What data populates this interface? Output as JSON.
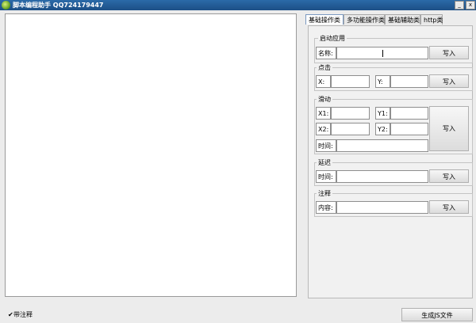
{
  "window": {
    "title": "脚本编程助手 QQ724179447",
    "minimize": "_",
    "close": "x"
  },
  "tabs": [
    "基础操作类",
    "多功能操作类",
    "基础辅助类",
    "http类"
  ],
  "launch_app": {
    "title": "启动应用",
    "name_label": "名称:",
    "name_value": "",
    "write": "写入"
  },
  "click": {
    "title": "点击",
    "x_label": "X:",
    "y_label": "Y:",
    "x_value": "",
    "y_value": "",
    "write": "写入"
  },
  "swipe": {
    "title": "滑动",
    "x1_label": "X1:",
    "y1_label": "Y1:",
    "x2_label": "X2:",
    "y2_label": "Y2:",
    "time_label": "时间:",
    "x1_value": "",
    "y1_value": "",
    "x2_value": "",
    "y2_value": "",
    "time_value": "",
    "write": "写入"
  },
  "delay": {
    "title": "延迟",
    "time_label": "时间:",
    "time_value": "",
    "write": "写入"
  },
  "comment": {
    "title": "注释",
    "content_label": "内容:",
    "content_value": "",
    "write": "写入"
  },
  "footer": {
    "checkbox_mark": "✔",
    "checkbox_label": "带注释",
    "checkbox_checked": true,
    "generate_button": "生成JS文件"
  }
}
